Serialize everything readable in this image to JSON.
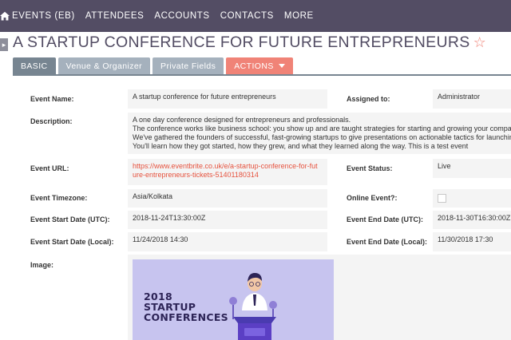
{
  "nav": {
    "items": [
      "EVENTS (EB)",
      "ATTENDEES",
      "ACCOUNTS",
      "CONTACTS",
      "MORE"
    ]
  },
  "page": {
    "title": "A STARTUP CONFERENCE FOR FUTURE ENTREPRENEURS"
  },
  "tabs": {
    "basic": "BASIC",
    "venue": "Venue & Organizer",
    "private": "Private Fields",
    "actions": "ACTIONS"
  },
  "fields": {
    "event_name": {
      "label": "Event Name:",
      "value": "A startup conference for future entrepreneurs"
    },
    "assigned_to": {
      "label": "Assigned to:",
      "value": "Administrator"
    },
    "description": {
      "label": "Description:",
      "lines": [
        "A one day conference designed for entrepreneurs and professionals.",
        "The conference works like business school: you show up and are taught strategies for starting and growing your company.",
        "We've gathered the founders of successful, fast-growing startups to give presentations on actionable tactics for launching and",
        "You'll learn how they got started, how they grew, and what they learned along the way. This is a test event"
      ]
    },
    "event_url": {
      "label": "Event URL:",
      "value": "https://www.eventbrite.co.uk/e/a-startup-conference-for-future-entrepreneurs-tickets-51401180314"
    },
    "event_status": {
      "label": "Event Status:",
      "value": "Live"
    },
    "event_timezone": {
      "label": "Event Timezone:",
      "value": "Asia/Kolkata"
    },
    "online_event": {
      "label": "Online Event?:",
      "checked": false
    },
    "start_utc": {
      "label": "Event Start Date (UTC):",
      "value": "2018-11-24T13:30:00Z"
    },
    "end_utc": {
      "label": "Event End Date (UTC):",
      "value": "2018-11-30T16:30:00Z"
    },
    "start_local": {
      "label": "Event Start Date (Local):",
      "value": "11/24/2018 14:30"
    },
    "end_local": {
      "label": "Event End Date (Local):",
      "value": "11/30/2018 17:30"
    },
    "image": {
      "label": "Image:",
      "text_line1": "2018",
      "text_line2": "STARTUP",
      "text_line3": "CONFERENCES"
    }
  },
  "colors": {
    "nav_bg": "#534d64",
    "tab_active": "#778591",
    "tab_inactive": "#a5b1bd",
    "actions": "#f08377",
    "link": "#e6523e",
    "image_bg": "#c7c4ef",
    "podium": "#5b3fc4"
  },
  "icons": {
    "home": "home-icon",
    "favorite": "star-outline-icon",
    "sidebar": "chevron-right-icon",
    "dropdown": "caret-down-icon"
  }
}
